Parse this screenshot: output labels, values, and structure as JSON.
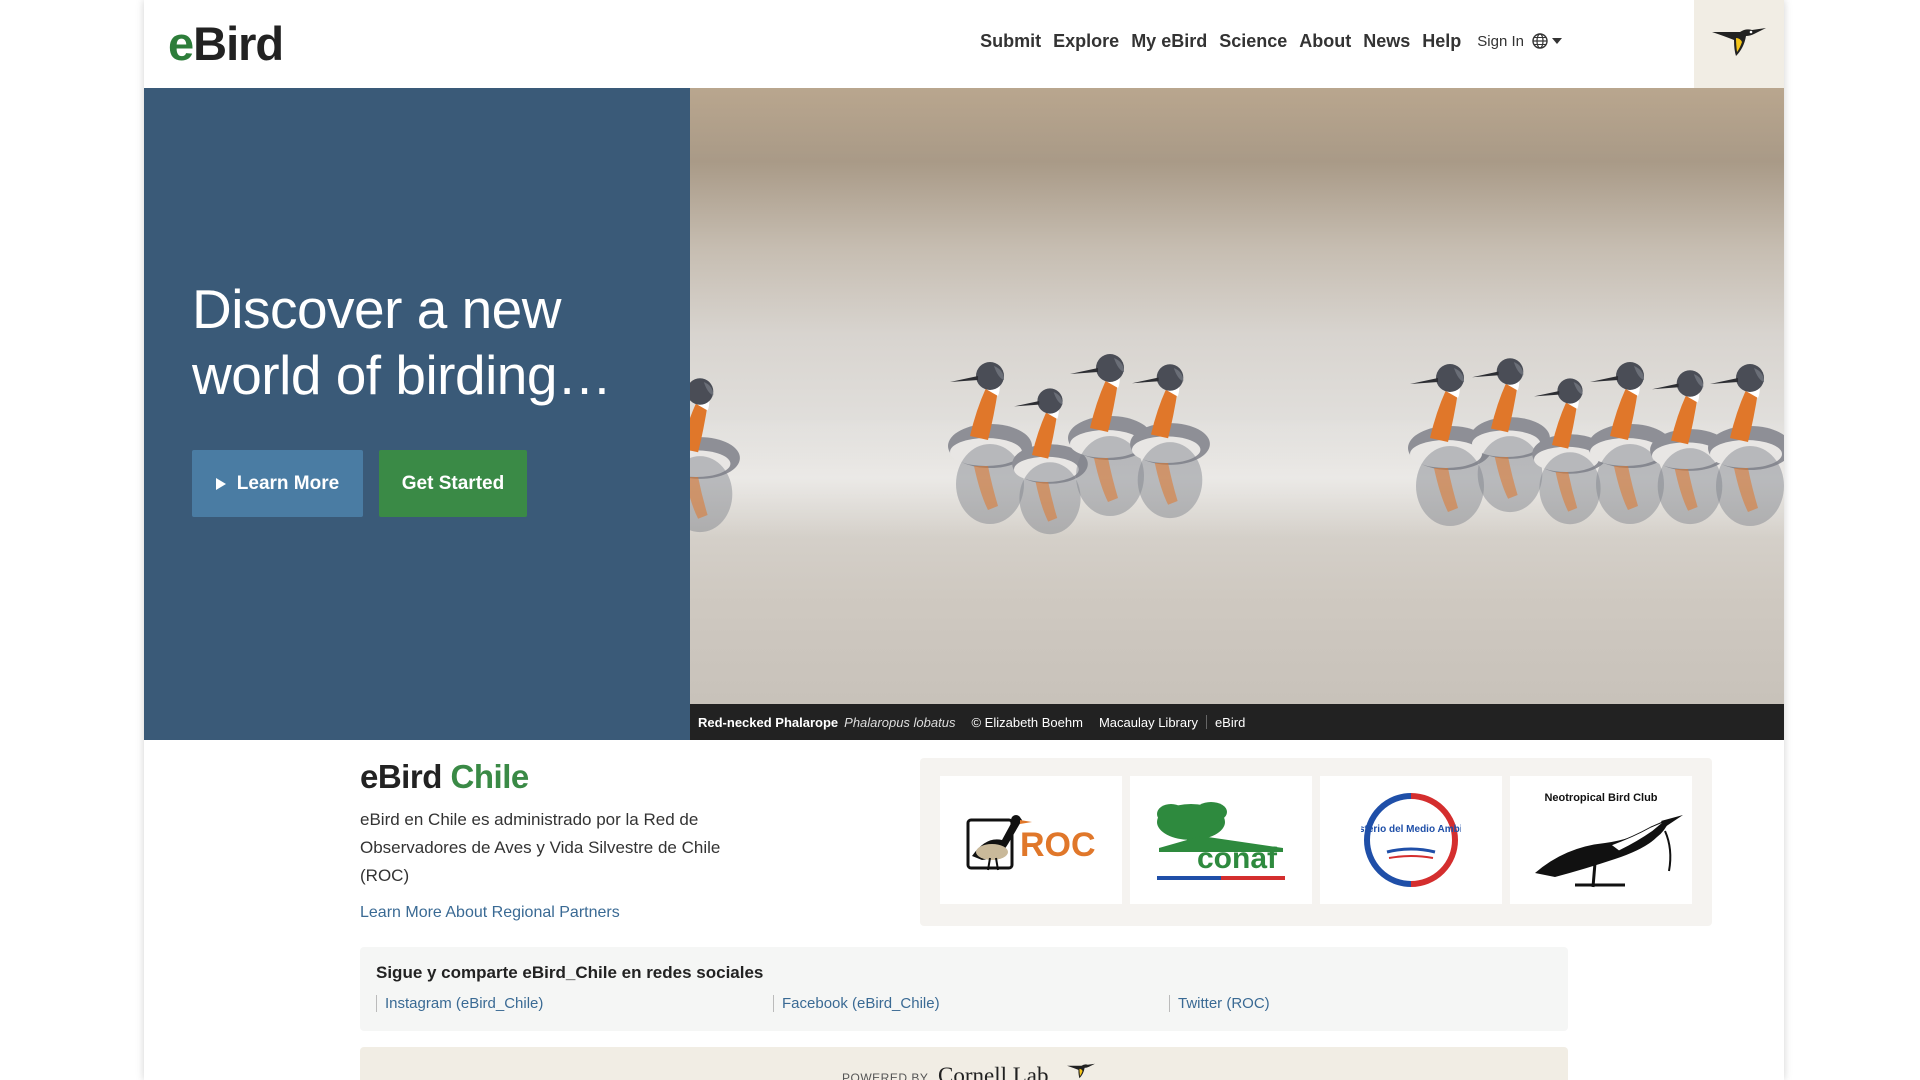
{
  "header": {
    "logo_e": "e",
    "logo_rest": "Bird",
    "nav": [
      "Submit",
      "Explore",
      "My eBird",
      "Science",
      "About",
      "News",
      "Help"
    ],
    "sign_in": "Sign In"
  },
  "hero": {
    "headline": "Discover a new world of birding…",
    "learn_more": "Learn More",
    "get_started": "Get Started",
    "caption": {
      "common_name": "Red-necked Phalarope",
      "scientific_name": "Phalaropus lobatus",
      "credit": "© Elizabeth Boehm",
      "library": "Macaulay Library",
      "source": "eBird"
    }
  },
  "regional": {
    "title_prefix": "eBird",
    "title_region": "Chile",
    "description": "eBird en Chile es administrado por la Red de Observadores de Aves y Vida Silvestre de Chile (ROC)",
    "link": "Learn More About Regional Partners",
    "partners": {
      "roc": "ROC",
      "conaf": "conaf",
      "ministerio": "Ministerio del Medio Ambiente",
      "nbc": "Neotropical Bird Club"
    }
  },
  "social": {
    "title": "Sigue y comparte eBird_Chile en redes sociales",
    "links": [
      "Instagram (eBird_Chile)",
      "Facebook (eBird_Chile)",
      "Twitter (ROC)"
    ]
  },
  "footer": {
    "powered_by": "POWERED BY",
    "cornell": "Cornell Lab"
  },
  "colors": {
    "brand_green": "#2d7d3a",
    "hero_blue": "#3a5a78",
    "learn_button": "#4a7ca3",
    "start_button": "#3a8a46",
    "link_blue": "#3a6a94"
  }
}
